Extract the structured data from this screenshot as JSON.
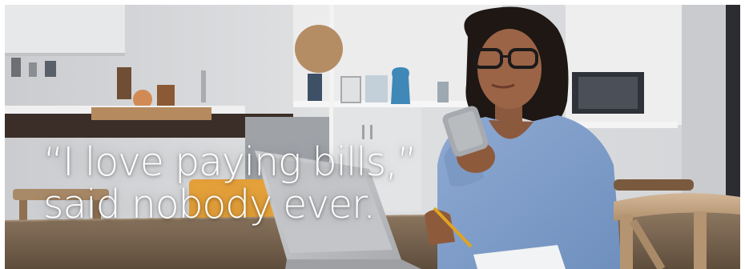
{
  "banner": {
    "headline_line1": "“I love paying bills,”",
    "headline_line2": "said nobody ever.",
    "photo": "woman-using-phone-at-home-photo"
  },
  "colors": {
    "headline": "#ffffff",
    "sweater": "#7f9fcb",
    "background_wall": "#e4e4e5"
  }
}
